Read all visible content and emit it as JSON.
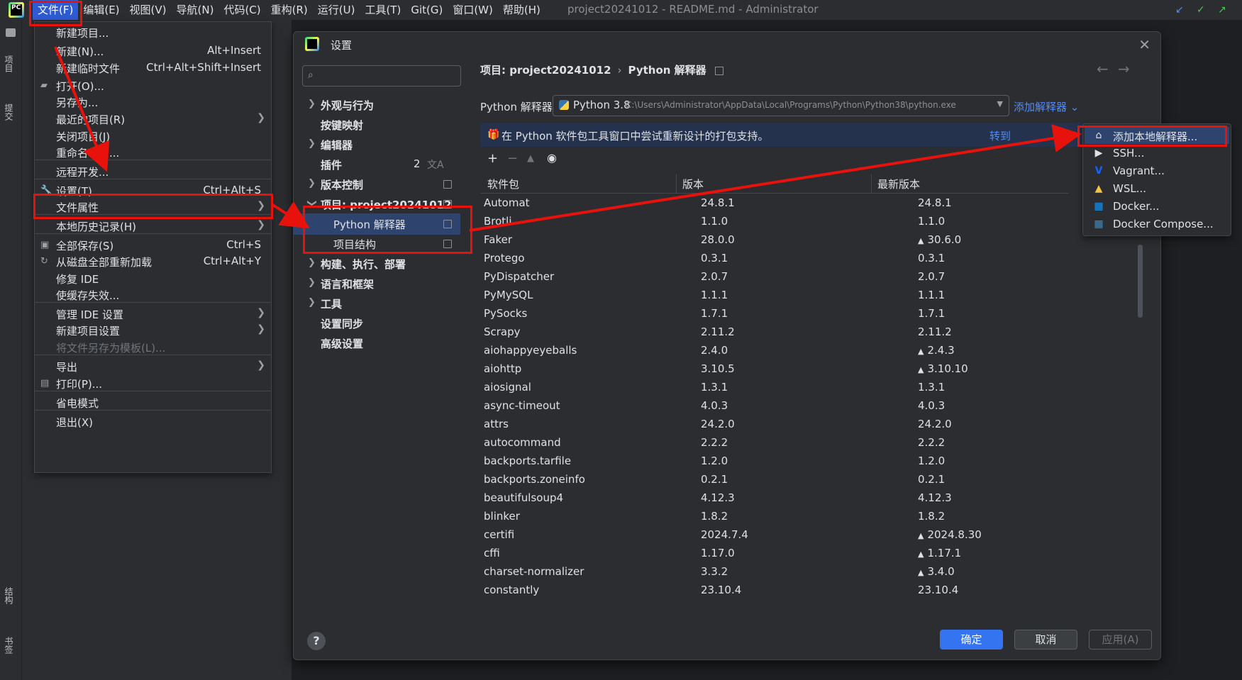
{
  "menubar": {
    "items": [
      "文件(F)",
      "编辑(E)",
      "视图(V)",
      "导航(N)",
      "代码(C)",
      "重构(R)",
      "运行(U)",
      "工具(T)",
      "Git(G)",
      "窗口(W)",
      "帮助(H)"
    ],
    "window_title": "project20241012 - README.md - Administrator"
  },
  "left_strip": {
    "top_label": "项目",
    "commit_label": "提交",
    "structure_label": "结构",
    "bookmarks_label": "书签"
  },
  "file_menu": {
    "items": [
      {
        "label": "新建项目...",
        "shortcut": ""
      },
      {
        "label": "新建(N)...",
        "shortcut": "Alt+Insert"
      },
      {
        "label": "新建临时文件",
        "shortcut": "Ctrl+Alt+Shift+Insert"
      },
      {
        "label": "打开(O)...",
        "shortcut": ""
      },
      {
        "label": "另存为...",
        "shortcut": ""
      },
      {
        "label": "最近的项目(R)",
        "shortcut": ""
      },
      {
        "label": "关闭项目(J)",
        "shortcut": ""
      },
      {
        "label": "重命名项目...",
        "shortcut": ""
      },
      {
        "label": "远程开发...",
        "shortcut": ""
      },
      {
        "label": "设置(T)...",
        "shortcut": "Ctrl+Alt+S"
      },
      {
        "label": "文件属性",
        "shortcut": ""
      },
      {
        "label": "本地历史记录(H)",
        "shortcut": ""
      },
      {
        "label": "全部保存(S)",
        "shortcut": "Ctrl+S"
      },
      {
        "label": "从磁盘全部重新加载",
        "shortcut": "Ctrl+Alt+Y"
      },
      {
        "label": "修复 IDE",
        "shortcut": ""
      },
      {
        "label": "使缓存失效...",
        "shortcut": ""
      },
      {
        "label": "管理 IDE 设置",
        "shortcut": ""
      },
      {
        "label": "新建项目设置",
        "shortcut": ""
      },
      {
        "label": "将文件另存为模板(L)...",
        "shortcut": ""
      },
      {
        "label": "导出",
        "shortcut": ""
      },
      {
        "label": "打印(P)...",
        "shortcut": ""
      },
      {
        "label": "省电模式",
        "shortcut": ""
      },
      {
        "label": "退出(X)",
        "shortcut": ""
      }
    ]
  },
  "dialog": {
    "title": "设置",
    "search_placeholder": "",
    "tree": [
      {
        "label": "外观与行为"
      },
      {
        "label": "按键映射"
      },
      {
        "label": "编辑器"
      },
      {
        "label": "插件",
        "badge": "2"
      },
      {
        "label": "版本控制"
      },
      {
        "label": "项目: project20241012"
      },
      {
        "label": "Python 解释器"
      },
      {
        "label": "项目结构"
      },
      {
        "label": "构建、执行、部署"
      },
      {
        "label": "语言和框架"
      },
      {
        "label": "工具"
      },
      {
        "label": "设置同步"
      },
      {
        "label": "高级设置"
      }
    ],
    "breadcrumb": {
      "project": "项目: project20241012",
      "page": "Python 解释器"
    },
    "interpreter_label": "Python 解释器:",
    "interpreter_name": "Python 3.8",
    "interpreter_path": "C:\\Users\\Administrator\\AppData\\Local\\Programs\\Python\\Python38\\python.exe",
    "add_interpreter": "添加解释器",
    "banner_message": "在 Python 软件包工具窗口中尝试重新设计的打包支持。",
    "banner_link": "转到",
    "columns": [
      "软件包",
      "版本",
      "最新版本"
    ],
    "packages": [
      {
        "name": "Automat",
        "version": "24.8.1",
        "latest": "24.8.1",
        "upgrade": false
      },
      {
        "name": "Brotli",
        "version": "1.1.0",
        "latest": "1.1.0",
        "upgrade": false
      },
      {
        "name": "Faker",
        "version": "28.0.0",
        "latest": "30.6.0",
        "upgrade": true
      },
      {
        "name": "Protego",
        "version": "0.3.1",
        "latest": "0.3.1",
        "upgrade": false
      },
      {
        "name": "PyDispatcher",
        "version": "2.0.7",
        "latest": "2.0.7",
        "upgrade": false
      },
      {
        "name": "PyMySQL",
        "version": "1.1.1",
        "latest": "1.1.1",
        "upgrade": false
      },
      {
        "name": "PySocks",
        "version": "1.7.1",
        "latest": "1.7.1",
        "upgrade": false
      },
      {
        "name": "Scrapy",
        "version": "2.11.2",
        "latest": "2.11.2",
        "upgrade": false
      },
      {
        "name": "aiohappyeyeballs",
        "version": "2.4.0",
        "latest": "2.4.3",
        "upgrade": true
      },
      {
        "name": "aiohttp",
        "version": "3.10.5",
        "latest": "3.10.10",
        "upgrade": true
      },
      {
        "name": "aiosignal",
        "version": "1.3.1",
        "latest": "1.3.1",
        "upgrade": false
      },
      {
        "name": "async-timeout",
        "version": "4.0.3",
        "latest": "4.0.3",
        "upgrade": false
      },
      {
        "name": "attrs",
        "version": "24.2.0",
        "latest": "24.2.0",
        "upgrade": false
      },
      {
        "name": "autocommand",
        "version": "2.2.2",
        "latest": "2.2.2",
        "upgrade": false
      },
      {
        "name": "backports.tarfile",
        "version": "1.2.0",
        "latest": "1.2.0",
        "upgrade": false
      },
      {
        "name": "backports.zoneinfo",
        "version": "0.2.1",
        "latest": "0.2.1",
        "upgrade": false
      },
      {
        "name": "beautifulsoup4",
        "version": "4.12.3",
        "latest": "4.12.3",
        "upgrade": false
      },
      {
        "name": "blinker",
        "version": "1.8.2",
        "latest": "1.8.2",
        "upgrade": false
      },
      {
        "name": "certifi",
        "version": "2024.7.4",
        "latest": "2024.8.30",
        "upgrade": true
      },
      {
        "name": "cffi",
        "version": "1.17.0",
        "latest": "1.17.1",
        "upgrade": true
      },
      {
        "name": "charset-normalizer",
        "version": "3.3.2",
        "latest": "3.4.0",
        "upgrade": true
      },
      {
        "name": "constantly",
        "version": "23.10.4",
        "latest": "23.10.4",
        "upgrade": false
      }
    ],
    "buttons": {
      "ok": "确定",
      "cancel": "取消",
      "apply": "应用(A)",
      "help": "?"
    }
  },
  "add_interpreter_popup": {
    "items": [
      {
        "label": "添加本地解释器...",
        "icon": "home-icon"
      },
      {
        "label": "SSH...",
        "icon": "terminal-icon"
      },
      {
        "label": "Vagrant...",
        "icon": "vagrant-icon"
      },
      {
        "label": "WSL...",
        "icon": "linux-icon"
      },
      {
        "label": "Docker...",
        "icon": "docker-icon"
      },
      {
        "label": "Docker Compose...",
        "icon": "docker-compose-icon"
      }
    ]
  },
  "colors": {
    "annotation": "#e8120c",
    "accent": "#3574f0",
    "link": "#548af7"
  }
}
